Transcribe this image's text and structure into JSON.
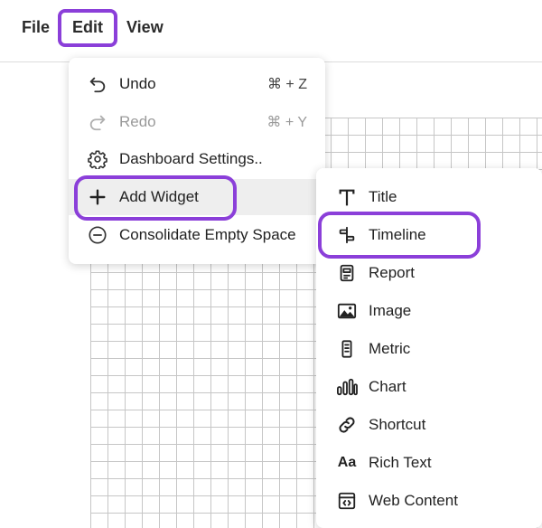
{
  "menubar": {
    "items": [
      {
        "label": "File"
      },
      {
        "label": "Edit"
      },
      {
        "label": "View"
      }
    ]
  },
  "edit_menu": {
    "items": [
      {
        "label": "Undo",
        "shortcut": "⌘ + Z",
        "icon": "undo-icon",
        "disabled": false
      },
      {
        "label": "Redo",
        "shortcut": "⌘ + Y",
        "icon": "redo-icon",
        "disabled": true
      },
      {
        "label": "Dashboard Settings..",
        "shortcut": "",
        "icon": "gear-icon",
        "disabled": false
      },
      {
        "label": "Add Widget",
        "shortcut": "",
        "icon": "plus-icon",
        "disabled": false
      },
      {
        "label": "Consolidate Empty Space",
        "shortcut": "",
        "icon": "minus-circle-icon",
        "disabled": false
      }
    ]
  },
  "widget_submenu": {
    "items": [
      {
        "label": "Title",
        "icon": "title-t-icon"
      },
      {
        "label": "Timeline",
        "icon": "timeline-icon"
      },
      {
        "label": "Report",
        "icon": "report-icon"
      },
      {
        "label": "Image",
        "icon": "image-icon"
      },
      {
        "label": "Metric",
        "icon": "metric-icon"
      },
      {
        "label": "Chart",
        "icon": "bar-chart-icon"
      },
      {
        "label": "Shortcut",
        "icon": "link-icon"
      },
      {
        "label": "Rich Text",
        "icon": "rich-text-icon",
        "glyph": "Aa"
      },
      {
        "label": "Web Content",
        "icon": "web-content-icon"
      }
    ]
  },
  "colors": {
    "highlight": "#8b3fd9",
    "hover_row": "#eeeeee",
    "disabled_text": "#9a9a9a"
  }
}
